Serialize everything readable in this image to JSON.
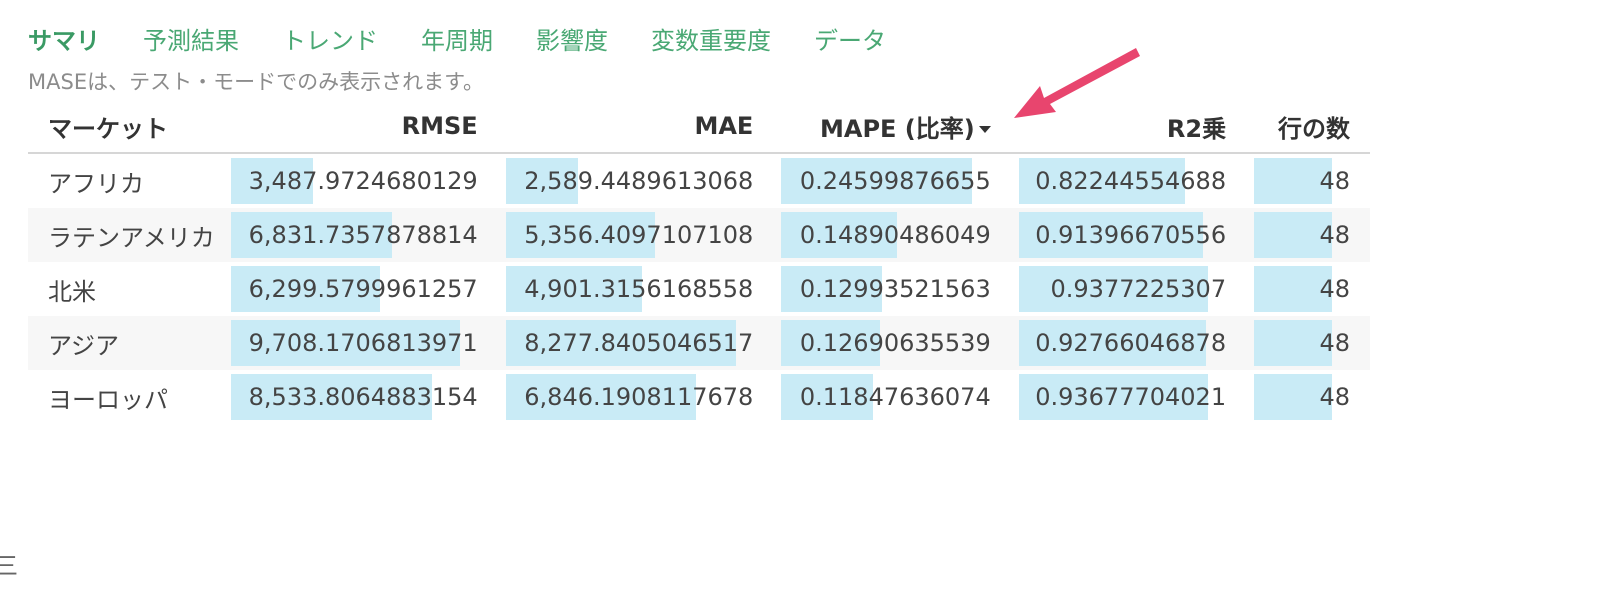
{
  "tabs": [
    {
      "label": "サマリ",
      "active": true
    },
    {
      "label": "予測結果",
      "active": false
    },
    {
      "label": "トレンド",
      "active": false
    },
    {
      "label": "年周期",
      "active": false
    },
    {
      "label": "影響度",
      "active": false
    },
    {
      "label": "変数重要度",
      "active": false
    },
    {
      "label": "データ",
      "active": false
    }
  ],
  "note": "MASEは、テスト・モードでのみ表示されます。",
  "table": {
    "headers": {
      "market": "マーケット",
      "rmse": "RMSE",
      "mae": "MAE",
      "mape": "MAPE (比率)",
      "r2": "R2乗",
      "count": "行の数"
    },
    "sorted_column": "mape",
    "sort_direction": "descending",
    "rows": [
      {
        "market": "アフリカ",
        "rmse": "3,487.9724680129",
        "mae": "2,589.4489613068",
        "mape": "0.24599876655",
        "r2": "0.82244554688",
        "count": "48"
      },
      {
        "market": "ラテンアメリカ",
        "rmse": "6,831.7357878814",
        "mae": "5,356.4097107108",
        "mape": "0.14890486049",
        "r2": "0.91396670556",
        "count": "48"
      },
      {
        "market": "北米",
        "rmse": "6,299.5799961257",
        "mae": "4,901.3156168558",
        "mape": "0.12993521563",
        "r2": "0.9377225307",
        "count": "48"
      },
      {
        "market": "アジア",
        "rmse": "9,708.1706813971",
        "mae": "8,277.8405046517",
        "mape": "0.12690635539",
        "r2": "0.92766046878",
        "count": "48"
      },
      {
        "market": "ヨーロッパ",
        "rmse": "8,533.8064883154",
        "mae": "6,846.1908117678",
        "mape": "0.11847636074",
        "r2": "0.93677704021",
        "count": "48"
      }
    ]
  },
  "colors": {
    "tab": "#4aa874",
    "bar": "#c9ebf6",
    "arrow": "#e8456e",
    "stripe": "#f7f7f7"
  },
  "edge_glyph": "三"
}
